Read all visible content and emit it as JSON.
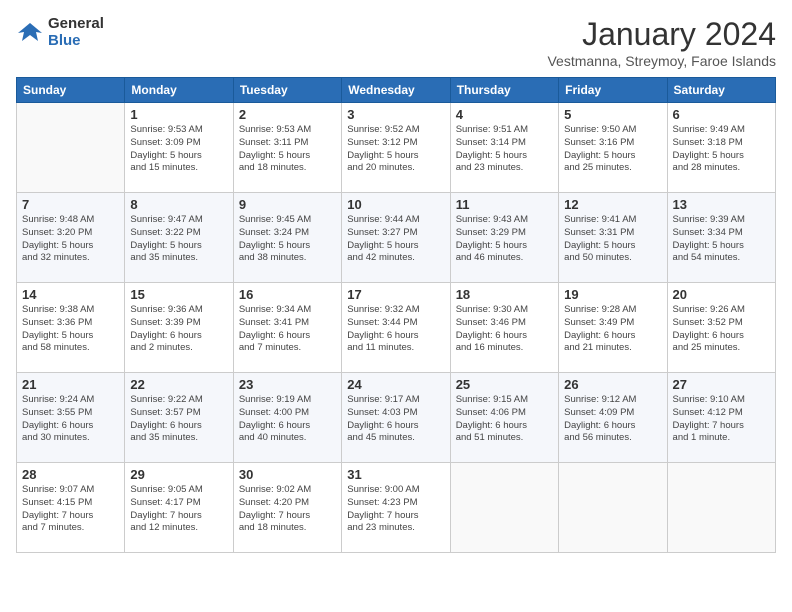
{
  "logo": {
    "general": "General",
    "blue": "Blue"
  },
  "header": {
    "month": "January 2024",
    "location": "Vestmanna, Streymoy, Faroe Islands"
  },
  "weekdays": [
    "Sunday",
    "Monday",
    "Tuesday",
    "Wednesday",
    "Thursday",
    "Friday",
    "Saturday"
  ],
  "weeks": [
    [
      {
        "day": "",
        "info": ""
      },
      {
        "day": "1",
        "info": "Sunrise: 9:53 AM\nSunset: 3:09 PM\nDaylight: 5 hours\nand 15 minutes."
      },
      {
        "day": "2",
        "info": "Sunrise: 9:53 AM\nSunset: 3:11 PM\nDaylight: 5 hours\nand 18 minutes."
      },
      {
        "day": "3",
        "info": "Sunrise: 9:52 AM\nSunset: 3:12 PM\nDaylight: 5 hours\nand 20 minutes."
      },
      {
        "day": "4",
        "info": "Sunrise: 9:51 AM\nSunset: 3:14 PM\nDaylight: 5 hours\nand 23 minutes."
      },
      {
        "day": "5",
        "info": "Sunrise: 9:50 AM\nSunset: 3:16 PM\nDaylight: 5 hours\nand 25 minutes."
      },
      {
        "day": "6",
        "info": "Sunrise: 9:49 AM\nSunset: 3:18 PM\nDaylight: 5 hours\nand 28 minutes."
      }
    ],
    [
      {
        "day": "7",
        "info": "Sunrise: 9:48 AM\nSunset: 3:20 PM\nDaylight: 5 hours\nand 32 minutes."
      },
      {
        "day": "8",
        "info": "Sunrise: 9:47 AM\nSunset: 3:22 PM\nDaylight: 5 hours\nand 35 minutes."
      },
      {
        "day": "9",
        "info": "Sunrise: 9:45 AM\nSunset: 3:24 PM\nDaylight: 5 hours\nand 38 minutes."
      },
      {
        "day": "10",
        "info": "Sunrise: 9:44 AM\nSunset: 3:27 PM\nDaylight: 5 hours\nand 42 minutes."
      },
      {
        "day": "11",
        "info": "Sunrise: 9:43 AM\nSunset: 3:29 PM\nDaylight: 5 hours\nand 46 minutes."
      },
      {
        "day": "12",
        "info": "Sunrise: 9:41 AM\nSunset: 3:31 PM\nDaylight: 5 hours\nand 50 minutes."
      },
      {
        "day": "13",
        "info": "Sunrise: 9:39 AM\nSunset: 3:34 PM\nDaylight: 5 hours\nand 54 minutes."
      }
    ],
    [
      {
        "day": "14",
        "info": "Sunrise: 9:38 AM\nSunset: 3:36 PM\nDaylight: 5 hours\nand 58 minutes."
      },
      {
        "day": "15",
        "info": "Sunrise: 9:36 AM\nSunset: 3:39 PM\nDaylight: 6 hours\nand 2 minutes."
      },
      {
        "day": "16",
        "info": "Sunrise: 9:34 AM\nSunset: 3:41 PM\nDaylight: 6 hours\nand 7 minutes."
      },
      {
        "day": "17",
        "info": "Sunrise: 9:32 AM\nSunset: 3:44 PM\nDaylight: 6 hours\nand 11 minutes."
      },
      {
        "day": "18",
        "info": "Sunrise: 9:30 AM\nSunset: 3:46 PM\nDaylight: 6 hours\nand 16 minutes."
      },
      {
        "day": "19",
        "info": "Sunrise: 9:28 AM\nSunset: 3:49 PM\nDaylight: 6 hours\nand 21 minutes."
      },
      {
        "day": "20",
        "info": "Sunrise: 9:26 AM\nSunset: 3:52 PM\nDaylight: 6 hours\nand 25 minutes."
      }
    ],
    [
      {
        "day": "21",
        "info": "Sunrise: 9:24 AM\nSunset: 3:55 PM\nDaylight: 6 hours\nand 30 minutes."
      },
      {
        "day": "22",
        "info": "Sunrise: 9:22 AM\nSunset: 3:57 PM\nDaylight: 6 hours\nand 35 minutes."
      },
      {
        "day": "23",
        "info": "Sunrise: 9:19 AM\nSunset: 4:00 PM\nDaylight: 6 hours\nand 40 minutes."
      },
      {
        "day": "24",
        "info": "Sunrise: 9:17 AM\nSunset: 4:03 PM\nDaylight: 6 hours\nand 45 minutes."
      },
      {
        "day": "25",
        "info": "Sunrise: 9:15 AM\nSunset: 4:06 PM\nDaylight: 6 hours\nand 51 minutes."
      },
      {
        "day": "26",
        "info": "Sunrise: 9:12 AM\nSunset: 4:09 PM\nDaylight: 6 hours\nand 56 minutes."
      },
      {
        "day": "27",
        "info": "Sunrise: 9:10 AM\nSunset: 4:12 PM\nDaylight: 7 hours\nand 1 minute."
      }
    ],
    [
      {
        "day": "28",
        "info": "Sunrise: 9:07 AM\nSunset: 4:15 PM\nDaylight: 7 hours\nand 7 minutes."
      },
      {
        "day": "29",
        "info": "Sunrise: 9:05 AM\nSunset: 4:17 PM\nDaylight: 7 hours\nand 12 minutes."
      },
      {
        "day": "30",
        "info": "Sunrise: 9:02 AM\nSunset: 4:20 PM\nDaylight: 7 hours\nand 18 minutes."
      },
      {
        "day": "31",
        "info": "Sunrise: 9:00 AM\nSunset: 4:23 PM\nDaylight: 7 hours\nand 23 minutes."
      },
      {
        "day": "",
        "info": ""
      },
      {
        "day": "",
        "info": ""
      },
      {
        "day": "",
        "info": ""
      }
    ]
  ]
}
